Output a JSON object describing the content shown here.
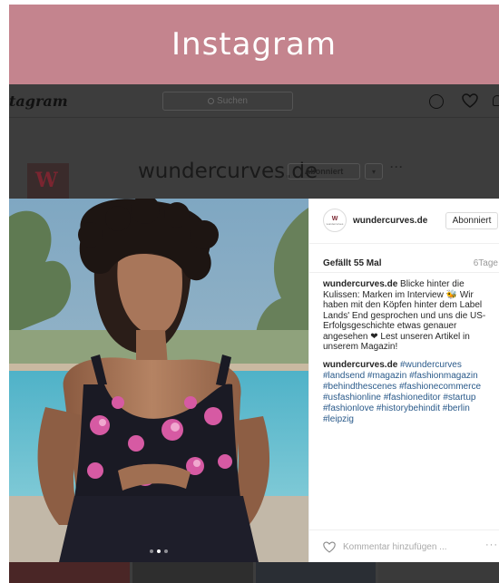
{
  "banner": {
    "title": "Instagram"
  },
  "ig_nav": {
    "logo": "tagram",
    "search_placeholder": "Suchen",
    "icons": [
      "explore-icon",
      "heart-icon",
      "user-icon"
    ]
  },
  "profile_backdrop": {
    "username": "wundercurves.de",
    "follow_label": "Abonniert",
    "dropdown_glyph": "▾",
    "more_glyph": "···"
  },
  "post": {
    "header": {
      "username": "wundercurves.de",
      "avatar_text": "W",
      "avatar_subtext": "wundercurves",
      "follow_label": "Abonniert"
    },
    "likes": "Gefällt 55 Mal",
    "time": "6Tage",
    "caption": {
      "user": "wundercurves.de",
      "text": "Blicke hinter die Kulissen: Marken im Interview 🐝 Wir haben mit den Köpfen hinter dem Label Lands' End gesprochen und uns die US-Erfolgsgeschichte etwas genauer angesehen ❤ Lest unseren Artikel in unserem Magazin!"
    },
    "comment": {
      "user": "wundercurves.de",
      "tags": "#wundercurves #landsend #magazin #fashionmagazin #behindthescenes #fashionecommerce #usfashionline #fashioneditor #startup #fashionlove #historybehindit #berlin #leipzig"
    },
    "comment_placeholder": "Kommentar hinzufügen ...",
    "more_glyph": "···",
    "carousel": {
      "count": 3,
      "active": 1
    }
  },
  "colors": {
    "banner": "#c4848e",
    "backdrop": "#3d3d3d",
    "link": "#2a5a8a",
    "avatar_brand": "#7a2530"
  }
}
